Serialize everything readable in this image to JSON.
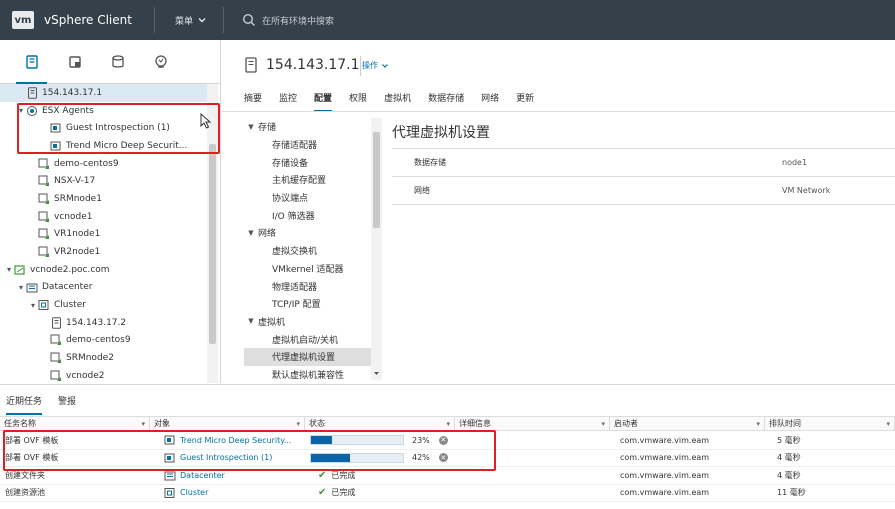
{
  "topbar": {
    "logo": "vm",
    "app_title": "vSphere Client",
    "menu_label": "菜单",
    "search_placeholder": "在所有环境中搜索"
  },
  "nav_icons": [
    "hosts-clusters-icon",
    "vms-templates-icon",
    "storage-icon",
    "network-icon"
  ],
  "tree": [
    {
      "label": "154.143.17.1",
      "indent": 1,
      "icon": "host-icon",
      "caret": "",
      "selected": true
    },
    {
      "label": "ESX Agents",
      "indent": 1,
      "icon": "resource-pool-icon",
      "caret": "▾"
    },
    {
      "label": "Guest Introspection (1)",
      "indent": 3,
      "icon": "vapp-icon",
      "caret": ""
    },
    {
      "label": "Trend Micro Deep Securit...",
      "indent": 3,
      "icon": "vapp-icon",
      "caret": ""
    },
    {
      "label": "demo-centos9",
      "indent": 2,
      "icon": "vm-icon",
      "caret": ""
    },
    {
      "label": "NSX-V-17",
      "indent": 2,
      "icon": "vm-icon",
      "caret": ""
    },
    {
      "label": "SRMnode1",
      "indent": 2,
      "icon": "vm-icon",
      "caret": ""
    },
    {
      "label": "vcnode1",
      "indent": 2,
      "icon": "vm-icon",
      "caret": ""
    },
    {
      "label": "VR1node1",
      "indent": 2,
      "icon": "vm-icon",
      "caret": ""
    },
    {
      "label": "VR2node1",
      "indent": 2,
      "icon": "vm-icon",
      "caret": ""
    },
    {
      "label": "vcnode2.poc.com",
      "indent": 0,
      "icon": "vcenter-icon",
      "caret": "▾"
    },
    {
      "label": "Datacenter",
      "indent": 1,
      "icon": "datacenter-icon",
      "caret": "▾"
    },
    {
      "label": "Cluster",
      "indent": 2,
      "icon": "cluster-icon",
      "caret": "▾"
    },
    {
      "label": "154.143.17.2",
      "indent": 3,
      "icon": "host-icon",
      "caret": ""
    },
    {
      "label": "demo-centos9",
      "indent": 3,
      "icon": "vm-icon",
      "caret": ""
    },
    {
      "label": "SRMnode2",
      "indent": 3,
      "icon": "vm-icon",
      "caret": ""
    },
    {
      "label": "vcnode2",
      "indent": 3,
      "icon": "vm-icon",
      "caret": ""
    }
  ],
  "header": {
    "host_title": "154.143.17.1",
    "actions_label": "操作"
  },
  "tabs": [
    "摘要",
    "监控",
    "配置",
    "权限",
    "虚拟机",
    "数据存储",
    "网络",
    "更新"
  ],
  "active_tab": 2,
  "config_nav": [
    {
      "type": "group",
      "label": "存储"
    },
    {
      "type": "item",
      "label": "存储适配器"
    },
    {
      "type": "item",
      "label": "存储设备"
    },
    {
      "type": "item",
      "label": "主机缓存配置"
    },
    {
      "type": "item",
      "label": "协议端点"
    },
    {
      "type": "item",
      "label": "I/O 筛选器"
    },
    {
      "type": "group",
      "label": "网络"
    },
    {
      "type": "item",
      "label": "虚拟交换机"
    },
    {
      "type": "item",
      "label": "VMkernel 适配器"
    },
    {
      "type": "item",
      "label": "物理适配器"
    },
    {
      "type": "item",
      "label": "TCP/IP 配置"
    },
    {
      "type": "group",
      "label": "虚拟机"
    },
    {
      "type": "item",
      "label": "虚拟机启动/关机"
    },
    {
      "type": "item",
      "label": "代理虚拟机设置",
      "selected": true
    },
    {
      "type": "item",
      "label": "默认虚拟机兼容性"
    }
  ],
  "settings": {
    "title": "代理虚拟机设置",
    "rows": [
      {
        "key": "数据存储",
        "value": "node1"
      },
      {
        "key": "网络",
        "value": "VM Network"
      }
    ]
  },
  "bottom": {
    "tabs": [
      "近期任务",
      "警报"
    ],
    "columns": [
      "任务名称",
      "对象",
      "状态",
      "详细信息",
      "启动者",
      "排队时间"
    ],
    "rows": [
      {
        "task": "部署 OVF 模板",
        "object": "Trend Micro Deep Security...",
        "object_icon": "vapp-icon",
        "status_type": "progress",
        "progress": 23,
        "status_text": "23%",
        "initiator": "com.vmware.vim.eam",
        "queued": "5 毫秒"
      },
      {
        "task": "部署 OVF 模板",
        "object": "Guest Introspection (1)",
        "object_icon": "vapp-icon",
        "status_type": "progress",
        "progress": 42,
        "status_text": "42%",
        "initiator": "com.vmware.vim.eam",
        "queued": "4 毫秒"
      },
      {
        "task": "创建文件夹",
        "object": "Datacenter",
        "object_icon": "datacenter-icon",
        "status_type": "done",
        "status_text": "已完成",
        "initiator": "com.vmware.vim.eam",
        "queued": "4 毫秒"
      },
      {
        "task": "创建资源池",
        "object": "Cluster",
        "object_icon": "cluster-icon",
        "status_type": "done",
        "status_text": "已完成",
        "initiator": "com.vmware.vim.eam",
        "queued": "11 毫秒"
      }
    ]
  }
}
